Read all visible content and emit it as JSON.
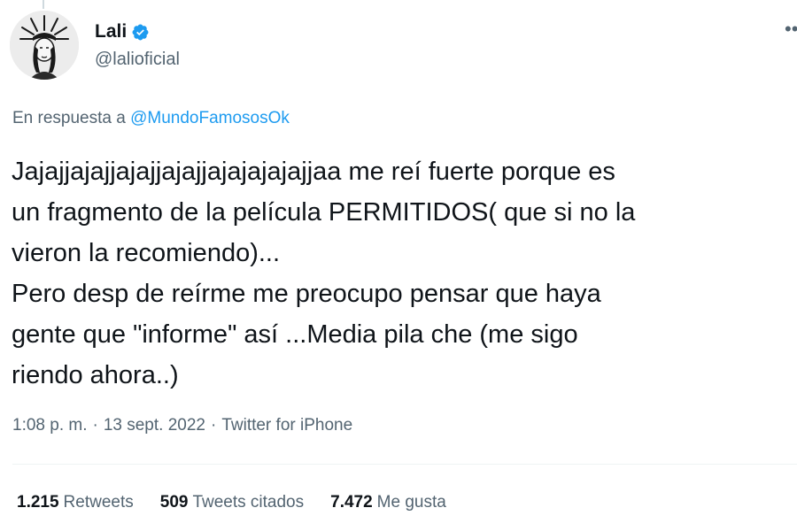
{
  "author": {
    "display_name": "Lali",
    "handle": "@lalioficial",
    "verified": true,
    "avatar_icon": "avatar-statue-of-liberty-sketch"
  },
  "reply": {
    "prefix": "En respuesta a",
    "mention": "@MundoFamososOk"
  },
  "tweet": {
    "lines": [
      "Jajajjajajjajajjajajjajajajajajjaa me reí fuerte porque es",
      "un fragmento de la película PERMITIDOS( que si no la",
      "vieron la recomiendo)...",
      "Pero desp de reírme me preocupo pensar que haya",
      "gente que \"informe\" así ...Media pila che (me sigo",
      "riendo ahora..)"
    ]
  },
  "meta": {
    "time": "1:08 p. m.",
    "separator": "·",
    "date": "13 sept. 2022",
    "source": "Twitter for iPhone"
  },
  "stats": {
    "retweets": {
      "count": "1.215",
      "label": "Retweets"
    },
    "quotes": {
      "count": "509",
      "label": "Tweets citados"
    },
    "likes": {
      "count": "7.472",
      "label": "Me gusta"
    }
  },
  "colors": {
    "accent": "#1d9bf0",
    "text_primary": "#0f1419",
    "text_secondary": "#536471",
    "divider": "#eff3f4"
  }
}
